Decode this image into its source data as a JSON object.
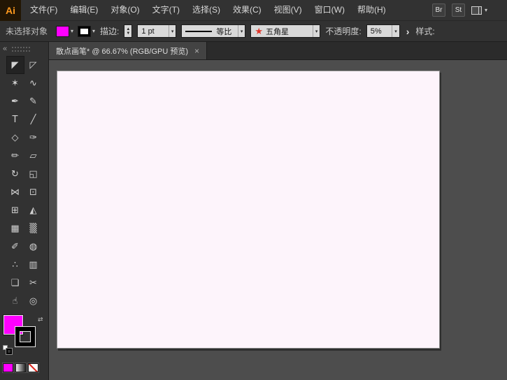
{
  "app": {
    "logo": "Ai"
  },
  "menu": {
    "items": [
      "文件(F)",
      "编辑(E)",
      "对象(O)",
      "文字(T)",
      "选择(S)",
      "效果(C)",
      "视图(V)",
      "窗口(W)",
      "帮助(H)"
    ]
  },
  "menubar_right": {
    "bridge": "Br",
    "stock": "St"
  },
  "ui": {
    "dropdown_arrow": "▾"
  },
  "control_bar": {
    "selection_status": "未选择对象",
    "stroke_label": "描边:",
    "stepper_up": "▲",
    "stepper_down": "▼",
    "stroke_width": "1 pt",
    "width_profile": "等比",
    "brush_icon": "★",
    "brush_name": "五角星",
    "opacity_label": "不透明度:",
    "opacity_value": "5%",
    "more_chevron": "›",
    "style_label": "样式:"
  },
  "document": {
    "tab_title": "散点画笔* @ 66.67% (RGB/GPU 预览)",
    "close": "×",
    "zoom_level": "66.67%",
    "color_mode": "RGB/GPU 预览"
  },
  "toolbar": {
    "collapse": "«",
    "swap_icon": "⇄",
    "tools": [
      {
        "name": "selection-tool",
        "glyph": "◤"
      },
      {
        "name": "direct-selection-tool",
        "glyph": "◸"
      },
      {
        "name": "magic-wand-tool",
        "glyph": "✶"
      },
      {
        "name": "lasso-tool",
        "glyph": "∿"
      },
      {
        "name": "pen-tool",
        "glyph": "✒"
      },
      {
        "name": "curvature-tool",
        "glyph": "✎"
      },
      {
        "name": "type-tool",
        "glyph": "T"
      },
      {
        "name": "line-segment-tool",
        "glyph": "╱"
      },
      {
        "name": "polygon-shape-tool",
        "glyph": "◇"
      },
      {
        "name": "paintbrush-tool",
        "glyph": "✑"
      },
      {
        "name": "shaper-tool",
        "glyph": "✏"
      },
      {
        "name": "eraser-tool",
        "glyph": "▱"
      },
      {
        "name": "rotate-tool",
        "glyph": "↻"
      },
      {
        "name": "scale-tool",
        "glyph": "◱"
      },
      {
        "name": "width-tool",
        "glyph": "⋈"
      },
      {
        "name": "free-transform-tool",
        "glyph": "⊡"
      },
      {
        "name": "shape-builder-tool",
        "glyph": "⊞"
      },
      {
        "name": "perspective-grid-tool",
        "glyph": "◭"
      },
      {
        "name": "mesh-tool",
        "glyph": "▦"
      },
      {
        "name": "gradient-tool",
        "glyph": "▒"
      },
      {
        "name": "eyedropper-tool",
        "glyph": "✐"
      },
      {
        "name": "blend-tool",
        "glyph": "◍"
      },
      {
        "name": "symbol-sprayer-tool",
        "glyph": "∴"
      },
      {
        "name": "column-graph-tool",
        "glyph": "▥"
      },
      {
        "name": "artboard-tool",
        "glyph": "❏"
      },
      {
        "name": "slice-tool",
        "glyph": "✂"
      },
      {
        "name": "hand-tool",
        "glyph": "☝"
      },
      {
        "name": "zoom-tool",
        "glyph": "◎"
      }
    ]
  },
  "colors": {
    "accent_magenta": "#ff00ff",
    "stroke_black": "#000000",
    "brush_red": "#e03428",
    "artboard_tint": "#fdf4fb",
    "canvas_gray": "#4d4d4d",
    "ui_dark": "#323232"
  }
}
